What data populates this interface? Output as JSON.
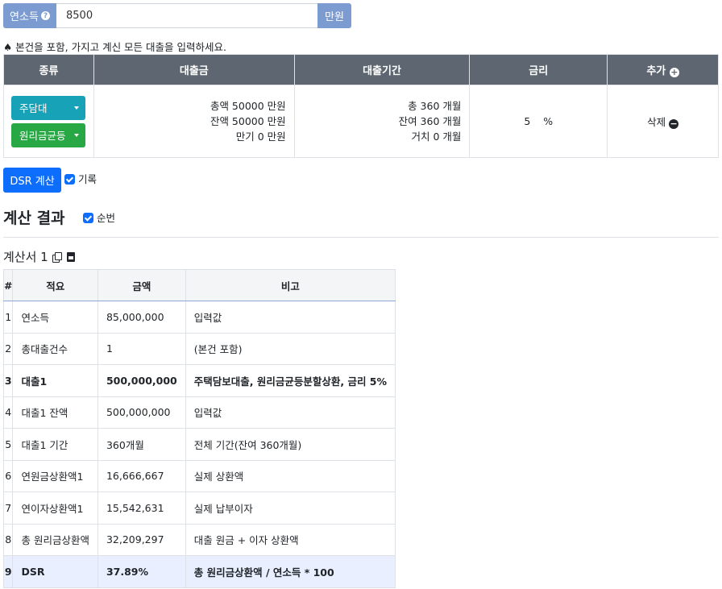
{
  "income": {
    "label": "연소득",
    "value": "8500",
    "unit": "만원"
  },
  "notice": "♠ 본건을 포함, 가지고 계신 모든 대출을 입력하세요.",
  "loan_table": {
    "headers": {
      "type": "종류",
      "amount": "대출금",
      "period": "대출기간",
      "rate": "금리",
      "add": "추가"
    },
    "row": {
      "type1": "주담대",
      "type2": "원리금균등",
      "amount_total": "총액 50000 만원",
      "amount_balance": "잔액 50000 만원",
      "amount_maturity": "만기 0 만원",
      "period_total": "총 360 개월",
      "period_remaining": "잔여 360 개월",
      "period_grace": "거치 0 개월",
      "rate_value": "5",
      "rate_unit": "%",
      "delete": "삭제"
    }
  },
  "dsr_button": "DSR 계산",
  "record_label": "기록",
  "result_title": "계산 결과",
  "sequence_label": "순번",
  "sheet_title": "계산서 1",
  "calc_table": {
    "headers": {
      "num": "#",
      "item": "적요",
      "amount": "금액",
      "note": "비고"
    },
    "rows": [
      {
        "num": "1",
        "item": "연소득",
        "amount": "85,000,000",
        "note": "입력값"
      },
      {
        "num": "2",
        "item": "총대출건수",
        "amount": "1",
        "note": "(본건 포함)"
      },
      {
        "num": "3",
        "item": "대출1",
        "amount": "500,000,000",
        "note": "주택담보대출, 원리금균등분할상환, 금리 5%"
      },
      {
        "num": "4",
        "item": "대출1 잔액",
        "amount": "500,000,000",
        "note": "입력값"
      },
      {
        "num": "5",
        "item": "대출1 기간",
        "amount": "360개월",
        "note": "전체 기간(잔여 360개월)"
      },
      {
        "num": "6",
        "item": "연원금상환액1",
        "amount": "16,666,667",
        "note": "실제 상환액"
      },
      {
        "num": "7",
        "item": "연이자상환액1",
        "amount": "15,542,631",
        "note": "실제 납부이자"
      },
      {
        "num": "8",
        "item": "총 원리금상환액",
        "amount": "32,209,297",
        "note": "대출 원금 + 이자 상환액"
      },
      {
        "num": "9",
        "item": "DSR",
        "amount": "37.89%",
        "note": "총 원리금상환액 / 연소득 * 100"
      }
    ]
  },
  "colors": {
    "primary": "#0d6efd",
    "teal": "#17a2b8",
    "green": "#28a745",
    "header_dark": "#5e6771",
    "input_group": "#7c9bd1",
    "highlight_row": "#e9efff"
  }
}
